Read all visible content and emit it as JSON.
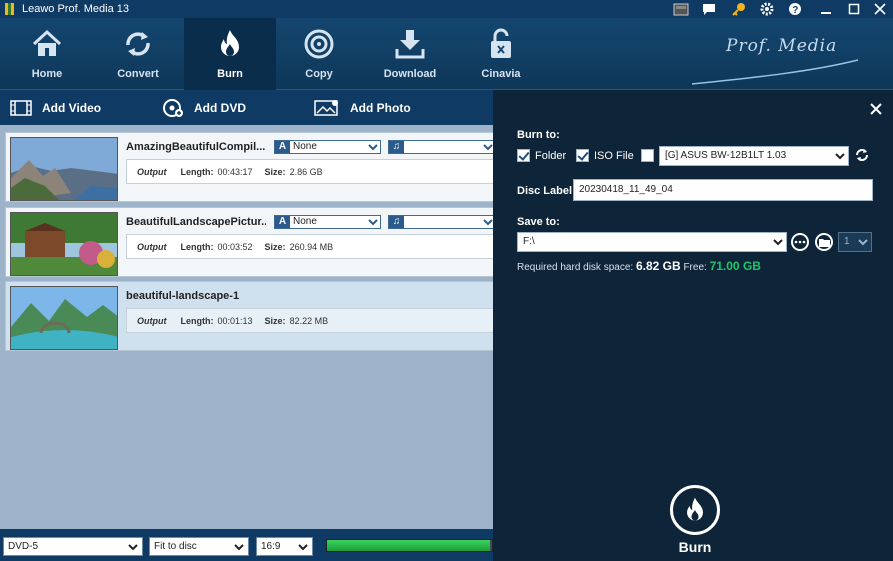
{
  "app": {
    "title": "Leawo Prof. Media 13",
    "brand": "Prof. Media"
  },
  "toolbar": [
    {
      "label": "Home",
      "icon": "home-icon"
    },
    {
      "label": "Convert",
      "icon": "convert-icon"
    },
    {
      "label": "Burn",
      "icon": "burn-icon",
      "active": true
    },
    {
      "label": "Copy",
      "icon": "copy-icon"
    },
    {
      "label": "Download",
      "icon": "download-icon"
    },
    {
      "label": "Cinavia",
      "icon": "cinavia-icon"
    }
  ],
  "addbar": {
    "add_video": "Add Video",
    "add_dvd": "Add DVD",
    "add_photo": "Add Photo"
  },
  "items": [
    {
      "name": "AmazingBeautifulCompil...",
      "subtitle": "None",
      "output_label": "Output",
      "length_label": "Length:",
      "length": "00:43:17",
      "size_label": "Size:",
      "size": "2.86 GB"
    },
    {
      "name": "BeautifulLandscapePictur...",
      "subtitle": "None",
      "output_label": "Output",
      "length_label": "Length:",
      "length": "00:03:52",
      "size_label": "Size:",
      "size": "260.94 MB"
    },
    {
      "name": "beautiful-landscape-1",
      "output_label": "Output",
      "length_label": "Length:",
      "length": "00:01:13",
      "size_label": "Size:",
      "size": "82.22 MB"
    }
  ],
  "panel": {
    "burn_to_label": "Burn to:",
    "folder_label": "Folder",
    "folder_checked": true,
    "iso_label": "ISO File",
    "iso_checked": true,
    "drive_checked": false,
    "drive": "[G] ASUS BW-12B1LT 1.03",
    "disc_label_label": "Disc Label:",
    "disc_label": "20230418_11_49_04",
    "save_to_label": "Save to:",
    "save_to": "F:\\",
    "copies": "1",
    "required_label": "Required hard disk space:",
    "required": "6.82 GB",
    "free_label": "Free:",
    "free": "71.00 GB",
    "burn_button": "Burn"
  },
  "statusbar": {
    "disc_type": "DVD-5",
    "fit": "Fit to disc",
    "aspect": "16:9",
    "progress_fraction": 0.99
  },
  "colors": {
    "accent": "#1fc56b",
    "panel": "#0e2438",
    "toolbar": "#0f3a63"
  }
}
